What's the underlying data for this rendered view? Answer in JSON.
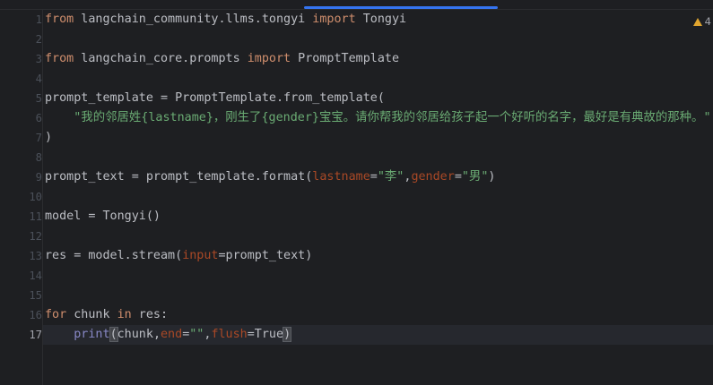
{
  "editor": {
    "accent_color": "#3574f0",
    "warnings": {
      "icon": "warning-icon",
      "count": "4"
    },
    "current_line": 17,
    "lines": [
      {
        "no": "1",
        "tokens": [
          {
            "t": "from",
            "c": "kw"
          },
          {
            "t": " langchain_community.llms.tongyi ",
            "c": "plain"
          },
          {
            "t": "import",
            "c": "kw"
          },
          {
            "t": " Tongyi",
            "c": "plain"
          }
        ]
      },
      {
        "no": "2",
        "tokens": []
      },
      {
        "no": "3",
        "tokens": [
          {
            "t": "from",
            "c": "kw"
          },
          {
            "t": " langchain_core.prompts ",
            "c": "plain"
          },
          {
            "t": "import",
            "c": "kw"
          },
          {
            "t": " PromptTemplate",
            "c": "plain"
          }
        ]
      },
      {
        "no": "4",
        "tokens": []
      },
      {
        "no": "5",
        "tokens": [
          {
            "t": "prompt_template = PromptTemplate.from_template(",
            "c": "plain"
          }
        ]
      },
      {
        "no": "6",
        "tokens": [
          {
            "t": "    ",
            "c": "plain"
          },
          {
            "t": "\"我的邻居姓{lastname}，刚生了{gender}宝宝。请你帮我的邻居给孩子起一个好听的名字，最好是有典故的那种。\"",
            "c": "str"
          }
        ]
      },
      {
        "no": "7",
        "tokens": [
          {
            "t": ")",
            "c": "plain"
          }
        ]
      },
      {
        "no": "8",
        "tokens": []
      },
      {
        "no": "9",
        "tokens": [
          {
            "t": "prompt_text = prompt_template.format(",
            "c": "plain"
          },
          {
            "t": "lastname",
            "c": "param"
          },
          {
            "t": "=",
            "c": "plain"
          },
          {
            "t": "\"李\"",
            "c": "str"
          },
          {
            "t": ",",
            "c": "plain"
          },
          {
            "t": "gender",
            "c": "param"
          },
          {
            "t": "=",
            "c": "plain"
          },
          {
            "t": "\"男\"",
            "c": "str"
          },
          {
            "t": ")",
            "c": "plain"
          }
        ]
      },
      {
        "no": "10",
        "tokens": []
      },
      {
        "no": "11",
        "tokens": [
          {
            "t": "model = Tongyi()",
            "c": "plain"
          }
        ]
      },
      {
        "no": "12",
        "tokens": []
      },
      {
        "no": "13",
        "tokens": [
          {
            "t": "res = model.stream(",
            "c": "plain"
          },
          {
            "t": "input",
            "c": "param"
          },
          {
            "t": "=prompt_text)",
            "c": "plain"
          }
        ]
      },
      {
        "no": "14",
        "tokens": []
      },
      {
        "no": "15",
        "tokens": []
      },
      {
        "no": "16",
        "tokens": [
          {
            "t": "for",
            "c": "kw"
          },
          {
            "t": " chunk ",
            "c": "plain"
          },
          {
            "t": "in",
            "c": "kw"
          },
          {
            "t": " res:",
            "c": "plain"
          }
        ]
      },
      {
        "no": "17",
        "tokens": [
          {
            "t": "    ",
            "c": "plain"
          },
          {
            "t": "print",
            "c": "builtin"
          },
          {
            "t": "(",
            "c": "plain bracket-hl"
          },
          {
            "t": "chunk",
            "c": "plain"
          },
          {
            "t": ",",
            "c": "plain"
          },
          {
            "t": "end",
            "c": "param"
          },
          {
            "t": "=",
            "c": "plain"
          },
          {
            "t": "\"\"",
            "c": "str"
          },
          {
            "t": ",",
            "c": "plain"
          },
          {
            "t": "flush",
            "c": "param"
          },
          {
            "t": "=True",
            "c": "plain"
          },
          {
            "t": ")",
            "c": "plain bracket-hl"
          }
        ]
      }
    ]
  }
}
